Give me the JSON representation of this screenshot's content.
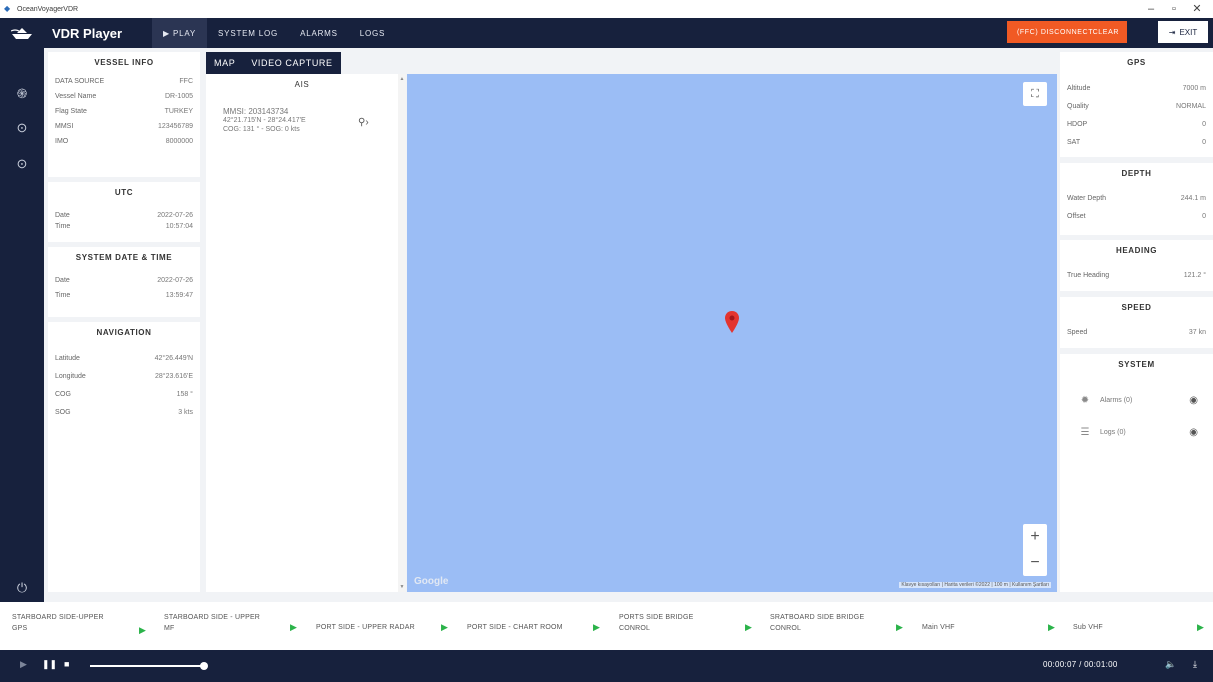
{
  "window": {
    "title": "OceanVoyagerVDR",
    "min": "–",
    "max": "▫",
    "close": "✕"
  },
  "topbar": {
    "brand": "VDR Player",
    "nav": [
      "▶ PLAY",
      "SYSTEM LOG",
      "ALARMS",
      "LOGS"
    ],
    "disconnect": "(FFC) DISCONNECT",
    "clear": "CLEAR",
    "exit": "EXIT",
    "colors": {
      "bar": "#17213d",
      "accent": "#f15a24"
    }
  },
  "rail": {
    "icons": [
      "fingerprint-icon",
      "disc-icon",
      "disc-icon",
      "logout-icon"
    ]
  },
  "vessel_info": {
    "title": "VESSEL INFO",
    "rows": [
      {
        "label": "DATA SOURCE",
        "value": "FFC"
      },
      {
        "label": "Vessel Name",
        "value": "DR-1005"
      },
      {
        "label": "Flag State",
        "value": "TURKEY"
      },
      {
        "label": "MMSI",
        "value": "123456789"
      },
      {
        "label": "IMO",
        "value": "8000000"
      }
    ]
  },
  "utc": {
    "title": "UTC",
    "rows": [
      {
        "label": "Date",
        "value": "2022-07-26"
      },
      {
        "label": "Time",
        "value": "10:57:04"
      }
    ]
  },
  "system_datetime": {
    "title": "SYSTEM DATE & TIME",
    "rows": [
      {
        "label": "Date",
        "value": "2022-07-26"
      },
      {
        "label": "Time",
        "value": "13:59:47"
      }
    ]
  },
  "navigation": {
    "title": "NAVIGATION",
    "rows": [
      {
        "label": "Latitude",
        "value": "42°26.449'N"
      },
      {
        "label": "Longitude",
        "value": "28°23.616'E"
      },
      {
        "label": "COG",
        "value": "158 °"
      },
      {
        "label": "SOG",
        "value": "3 kts"
      }
    ]
  },
  "tabs": [
    "MAP",
    "VIDEO CAPTURE"
  ],
  "ais": {
    "title": "AIS",
    "lines": [
      "MMSI: 203143734",
      "42°21.715'N - 28°24.417'E",
      "COG: 131 ° - SOG: 0 kts"
    ]
  },
  "map": {
    "google": "Google",
    "attribution": "Klavye kısayolları | Harita verileri ©2022 | 100 m | Kullanım Şartları",
    "zoom_in": "+",
    "zoom_out": "−",
    "background": "#9bbdf5",
    "marker_color": "#e3342f"
  },
  "gps": {
    "title": "GPS",
    "rows": [
      {
        "label": "Altitude",
        "value": "7000 m"
      },
      {
        "label": "Quality",
        "value": "NORMAL"
      },
      {
        "label": "HDOP",
        "value": "0"
      },
      {
        "label": "SAT",
        "value": "0"
      }
    ]
  },
  "depth": {
    "title": "DEPTH",
    "rows": [
      {
        "label": "Water Depth",
        "value": "244.1 m"
      },
      {
        "label": "Offset",
        "value": "0"
      }
    ]
  },
  "heading": {
    "title": "HEADING",
    "rows": [
      {
        "label": "True Heading",
        "value": "121.2 °"
      }
    ]
  },
  "speed": {
    "title": "SPEED",
    "rows": [
      {
        "label": "Speed",
        "value": "37 kn"
      }
    ]
  },
  "system": {
    "title": "SYSTEM",
    "alarms": "Alarms (0)",
    "logs": "Logs (0)"
  },
  "channels": [
    {
      "line1": "STARBOARD SIDE-UPPER",
      "line2": "GPS"
    },
    {
      "line1": "STARBOARD SIDE - UPPER",
      "line2": "MF"
    },
    {
      "line1": "PORT SIDE - UPPER RADAR",
      "line2": ""
    },
    {
      "line1": "PORT SIDE - CHART ROOM",
      "line2": ""
    },
    {
      "line1": "PORTS SIDE BRIDGE",
      "line2": "CONROL"
    },
    {
      "line1": "SRATBOARD SIDE BRIDGE",
      "line2": "CONROL"
    },
    {
      "line1": "Main VHF",
      "line2": ""
    },
    {
      "line1": "Sub VHF",
      "line2": ""
    }
  ],
  "player": {
    "time": "00:00:07 /  00:01:00",
    "progress": 0.12
  }
}
